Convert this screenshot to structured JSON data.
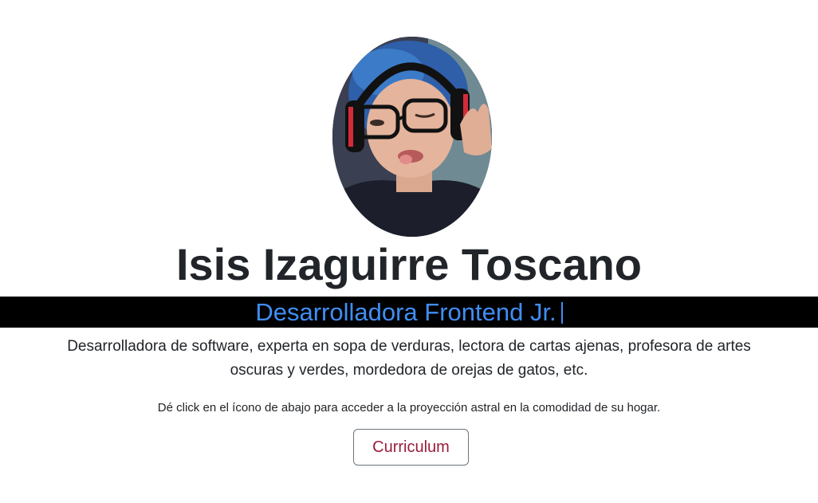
{
  "profile": {
    "photo_icon": "profile-photo",
    "name": "Isis Izaguirre Toscano",
    "role": "Desarrolladora Frontend Jr.",
    "bio": "Desarrolladora de software, experta en sopa de verduras, lectora de cartas ajenas, profesora de artes oscuras y verdes, mordedora de orejas de gatos, etc.",
    "hint": "Dé click en el ícono de abajo para acceder a la proyección astral en la comodidad de su hogar.",
    "button_label": "Curriculum"
  },
  "colors": {
    "role_bar_bg": "#000000",
    "role_text": "#3f8ef5",
    "button_text": "#9b1b3a",
    "button_border": "#6c757d",
    "heading": "#212529"
  }
}
